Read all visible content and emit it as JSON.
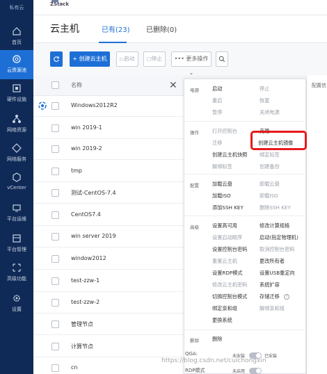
{
  "sidebar": {
    "top_label": "私有云",
    "items": [
      {
        "label": "首页",
        "icon": "home-icon"
      },
      {
        "label": "云资源池",
        "icon": "cloud-pool-icon"
      },
      {
        "label": "硬件设施",
        "icon": "hardware-icon"
      },
      {
        "label": "网络资源",
        "icon": "network-resource-icon"
      },
      {
        "label": "网络服务",
        "icon": "network-service-icon"
      },
      {
        "label": "vCenter",
        "icon": "vcenter-icon"
      },
      {
        "label": "平台运维",
        "icon": "ops-icon"
      },
      {
        "label": "平台管理",
        "icon": "platform-icon"
      },
      {
        "label": "高级功能",
        "icon": "advanced-icon"
      },
      {
        "label": "设置",
        "icon": "settings-icon"
      }
    ],
    "active_color": "#1d6fd6",
    "bg_color": "#0f2a56"
  },
  "topbar": {
    "brand": "ZStack"
  },
  "header": {
    "title": "云主机",
    "tabs": [
      {
        "label": "已有(23)",
        "active": true
      },
      {
        "label": "已删除(0)",
        "active": false
      }
    ]
  },
  "toolbar": {
    "create_label": "+ 创建云主机",
    "start_label": "启动",
    "stop_label": "停止",
    "more_label": "••• 更多操作 ⌄"
  },
  "table": {
    "header": "名称",
    "rows": [
      "Windows2012R2",
      "win 2019-1",
      "win 2019-2",
      "tmp",
      "测试-CentOS-7.4",
      "CentOS7.4",
      "win server 2019",
      "window2012",
      "test-zzw-1",
      "test-zzw-2",
      "管理节点",
      "计算节点",
      "cn"
    ]
  },
  "panel": {
    "sections": {
      "power": "电源",
      "ops": "操作",
      "config": "配置",
      "advanced": "高级",
      "delete": "删除"
    },
    "power": {
      "c1": [
        "启动",
        "重启",
        "暂停"
      ],
      "c2": [
        "停止",
        "恢复",
        "关闭电源"
      ]
    },
    "ops": {
      "c1": [
        "打开控制台",
        "迁移",
        "创建云主机快照",
        "解绑标签"
      ],
      "c2": [
        "克隆",
        "创建云主机镜像",
        "绑定标签",
        "创建备份"
      ]
    },
    "config": {
      "c1": [
        "加载云盘",
        "加载ISO",
        "添加SSH KEY"
      ],
      "c2": [
        "卸载云盘",
        "卸载ISO",
        "删除SSH KEY"
      ]
    },
    "advanced": {
      "c1": [
        "设置高可用",
        "设置启动顺序",
        "设置控制台密码",
        "重置云主机",
        "设置RDP模式",
        "修改云主机密码",
        "切换控制台模式",
        "绑定亲和组",
        "更换系统"
      ],
      "c2": [
        "修改计算规格",
        "启动(指定物理机)",
        "取消控制台密码",
        "更改所有者",
        "设置USB重定向",
        "系统扩容",
        "存储迁移",
        "解绑亲和组"
      ]
    },
    "delete": [
      "删除"
    ],
    "footer": {
      "qga_label": "QGA:",
      "qga_state": "未安装",
      "qga_value": "已安装",
      "rdp_label": "RDP模式",
      "rdp_state": "未启用"
    },
    "highlight_color": "#e8191a"
  },
  "right_edge": {
    "header": "配置信"
  },
  "watermark": "https://blog.csdn.net/cuichongxin"
}
